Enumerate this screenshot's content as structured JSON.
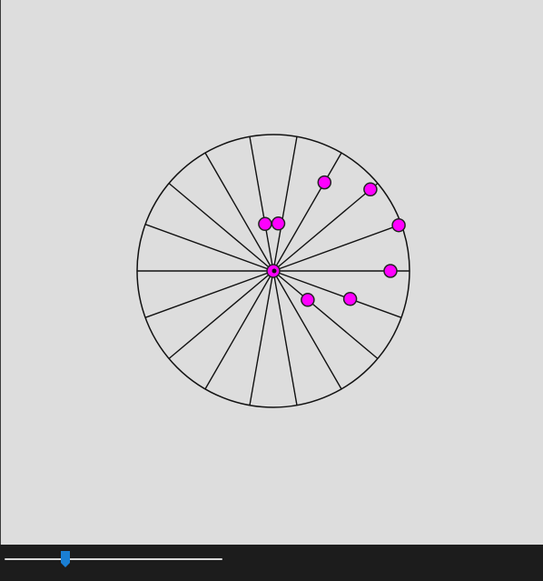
{
  "wheel": {
    "spoke_count": 18,
    "line_color": "#111111",
    "fill_color": "#dddddd",
    "marker_color": "#ff00ff",
    "marker_outline": "#222222"
  },
  "markers": [
    {
      "angle_deg": 84,
      "radius_frac": 0.35
    },
    {
      "angle_deg": 60,
      "radius_frac": 0.75
    },
    {
      "angle_deg": 40,
      "radius_frac": 0.93
    },
    {
      "angle_deg": 20,
      "radius_frac": 0.98
    },
    {
      "angle_deg": 0,
      "radius_frac": 0.86
    },
    {
      "angle_deg": -20,
      "radius_frac": 0.6
    },
    {
      "angle_deg": -40,
      "radius_frac": 0.33
    },
    {
      "angle_deg": 100,
      "radius_frac": 0.35
    },
    {
      "angle_deg": 0,
      "radius_frac": 0.0
    }
  ],
  "slider": {
    "value_fraction": 0.28,
    "track_color": "#d8d8d8",
    "thumb_color": "#1a7fd4"
  },
  "colors": {
    "canvas_bg": "#dddddd",
    "control_bar_bg": "#1c1c1c"
  }
}
